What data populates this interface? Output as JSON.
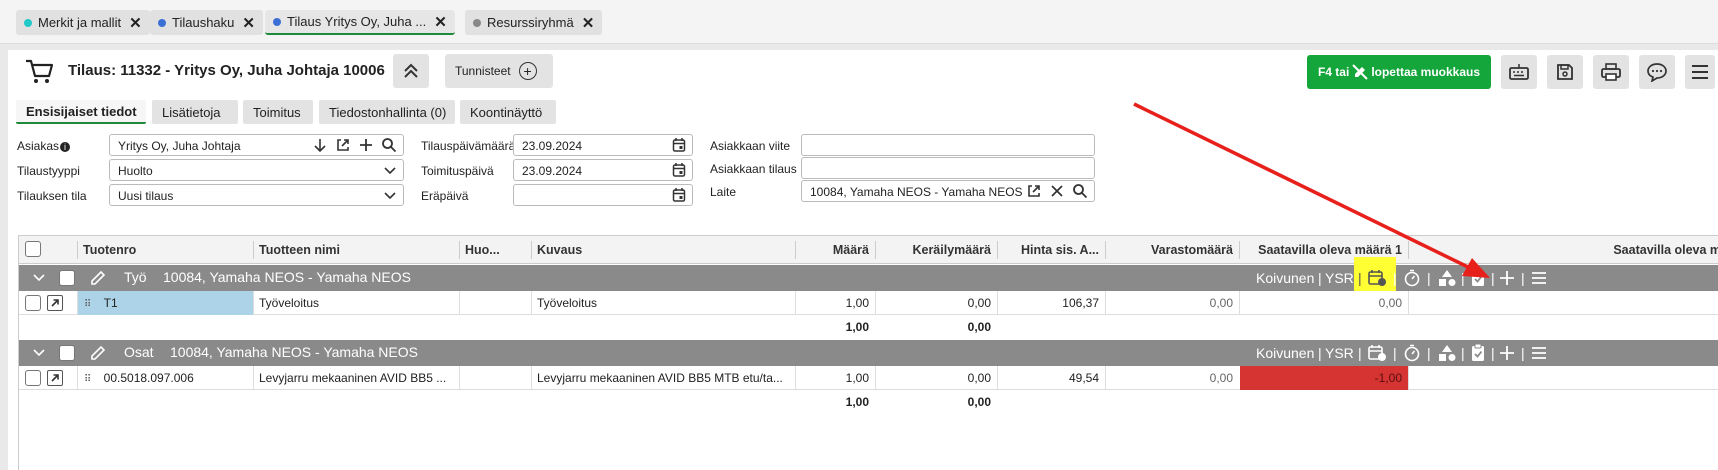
{
  "tabs": [
    {
      "label": "Merkit ja mallit",
      "dot": "#22c9c9"
    },
    {
      "label": "Tilaushaku",
      "dot": "#3b6fd6"
    },
    {
      "label": "Tilaus Yritys Oy, Juha ...",
      "dot": "#3b6fd6"
    },
    {
      "label": "Resurssiryhmä",
      "dot": "#888888"
    }
  ],
  "header": {
    "title": "Tilaus: 11332 - Yritys Oy, Juha Johtaja 10006",
    "tags_label": "Tunnisteet",
    "edit_button": "F4 tai",
    "edit_button_suffix": "lopettaa muokkaus"
  },
  "subtabs": [
    "Ensisijaiset tiedot",
    "Lisätietoja",
    "Toimitus",
    "Tiedostonhallinta (0)",
    "Koontinäyttö"
  ],
  "form": {
    "asiakas_label": "Asiakas",
    "asiakas_value": "Yritys Oy, Juha Johtaja",
    "tilaustyyppi_label": "Tilaustyyppi",
    "tilaustyyppi_value": "Huolto",
    "tila_label": "Tilauksen tila",
    "tila_value": "Uusi tilaus",
    "tilauspvm_label": "Tilauspäivämäärä",
    "tilauspvm_value": "23.09.2024",
    "toimituspvm_label": "Toimituspäivä",
    "toimituspvm_value": "23.09.2024",
    "erapaiva_label": "Eräpäivä",
    "erapaiva_value": "",
    "viite_label": "Asiakkaan viite",
    "viite_value": "",
    "asiakkaan_tilaus_label": "Asiakkaan tilaus",
    "asiakkaan_tilaus_value": "",
    "laite_label": "Laite",
    "laite_value": "10084, Yamaha NEOS - Yamaha NEOS"
  },
  "grid": {
    "columns": [
      "Tuotenro",
      "Tuotteen nimi",
      "Huo...",
      "Kuvaus",
      "Määrä",
      "Keräilymäärä",
      "Hinta sis. A...",
      "Varastomäärä",
      "Saatavilla oleva määrä 1",
      "Saatavilla oleva mä"
    ],
    "groups": [
      {
        "type": "Työ",
        "device": "10084, Yamaha NEOS - Yamaha NEOS",
        "user": "Koivunen",
        "code": "YSR",
        "rows": [
          {
            "tuotenro": "T1",
            "nimi": "Työveloitus",
            "huo": "",
            "kuvaus": "Työveloitus",
            "maara": "1,00",
            "kerailymaara": "0,00",
            "hinta": "106,37",
            "varasto": "0,00",
            "saatavilla": "0,00"
          }
        ],
        "sum_maara": "1,00",
        "sum_keraily": "0,00"
      },
      {
        "type": "Osat",
        "device": "10084, Yamaha NEOS - Yamaha NEOS",
        "user": "Koivunen",
        "code": "YSR",
        "rows": [
          {
            "tuotenro": "00.5018.097.006",
            "nimi": "Levyjarru mekaaninen AVID BB5 ...",
            "huo": "",
            "kuvaus": "Levyjarru mekaaninen AVID BB5 MTB etu/ta...",
            "maara": "1,00",
            "kerailymaara": "0,00",
            "hinta": "49,54",
            "varasto": "0,00",
            "saatavilla": "-1,00"
          }
        ],
        "sum_maara": "1,00",
        "sum_keraily": "0,00"
      }
    ]
  },
  "colors": {
    "accent_green": "#14a63b",
    "group_bar": "#8a8a8a",
    "negative_stock": "#d63333",
    "highlight": "#ffff33",
    "annotation_arrow": "#e8201c"
  }
}
